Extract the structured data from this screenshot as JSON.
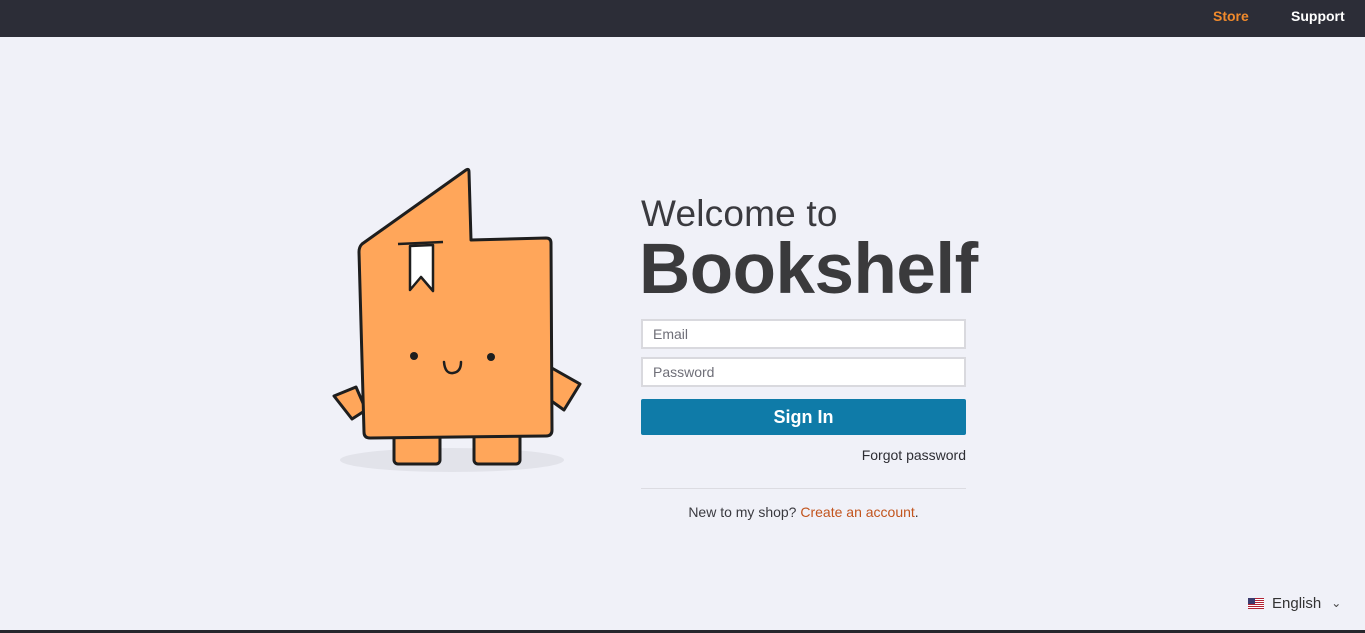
{
  "nav": {
    "store_label": "Store",
    "support_label": "Support"
  },
  "hero": {
    "welcome_text": "Welcome to",
    "brand_text": "Bookshelf",
    "mascot_icon": "bookshelf-mascot-icon"
  },
  "login_form": {
    "email_placeholder": "Email",
    "email_value": "",
    "password_placeholder": "Password",
    "password_value": "",
    "signin_label": "Sign In",
    "forgot_label": "Forgot password",
    "signup_prefix": "New to my shop?",
    "signup_link": "Create an account",
    "signup_suffix": "."
  },
  "language": {
    "selected": "English",
    "flag_icon": "us-flag-icon",
    "chevron_icon": "chevron-down-icon"
  },
  "colors": {
    "topbar_bg": "#2c2d37",
    "accent_orange": "#f08a2c",
    "button_blue": "#0f7ba8",
    "link_red": "#c2541d",
    "mascot_fill": "#ffa65a",
    "page_bg": "#f0f1f8"
  }
}
